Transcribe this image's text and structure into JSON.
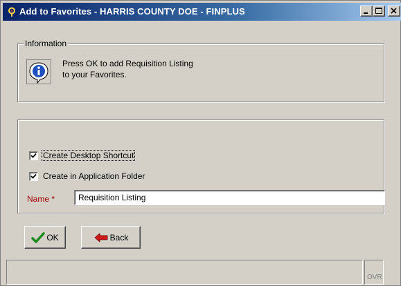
{
  "window": {
    "title": "Add to Favorites - HARRIS COUNTY DOE - FINPLUS",
    "app_icon": "finplus-app-icon",
    "caption_buttons": [
      "minimize-icon",
      "maximize-icon",
      "close-icon"
    ]
  },
  "information": {
    "legend": "Information",
    "icon": "info-icon",
    "message": "Press OK to add Requisition Listing\nto your Favorites."
  },
  "options": {
    "create_desktop_shortcut": {
      "label": "Create Desktop Shortcut",
      "checked": true
    },
    "create_in_app_folder": {
      "label": "Create in Application Folder",
      "checked": true
    },
    "name_label": "Name *",
    "name_value": "Requisition Listing"
  },
  "buttons": {
    "ok_label": "OK",
    "ok_icon": "green-checkmark-icon",
    "back_label": "Back",
    "back_icon": "red-back-arrow-icon"
  },
  "statusbar": {
    "ovr": "OVR"
  },
  "colors": {
    "titlebar_start": "#0a246a",
    "titlebar_end": "#a6caf0",
    "required_label": "#a00000",
    "window_face": "#d4d0c8"
  }
}
